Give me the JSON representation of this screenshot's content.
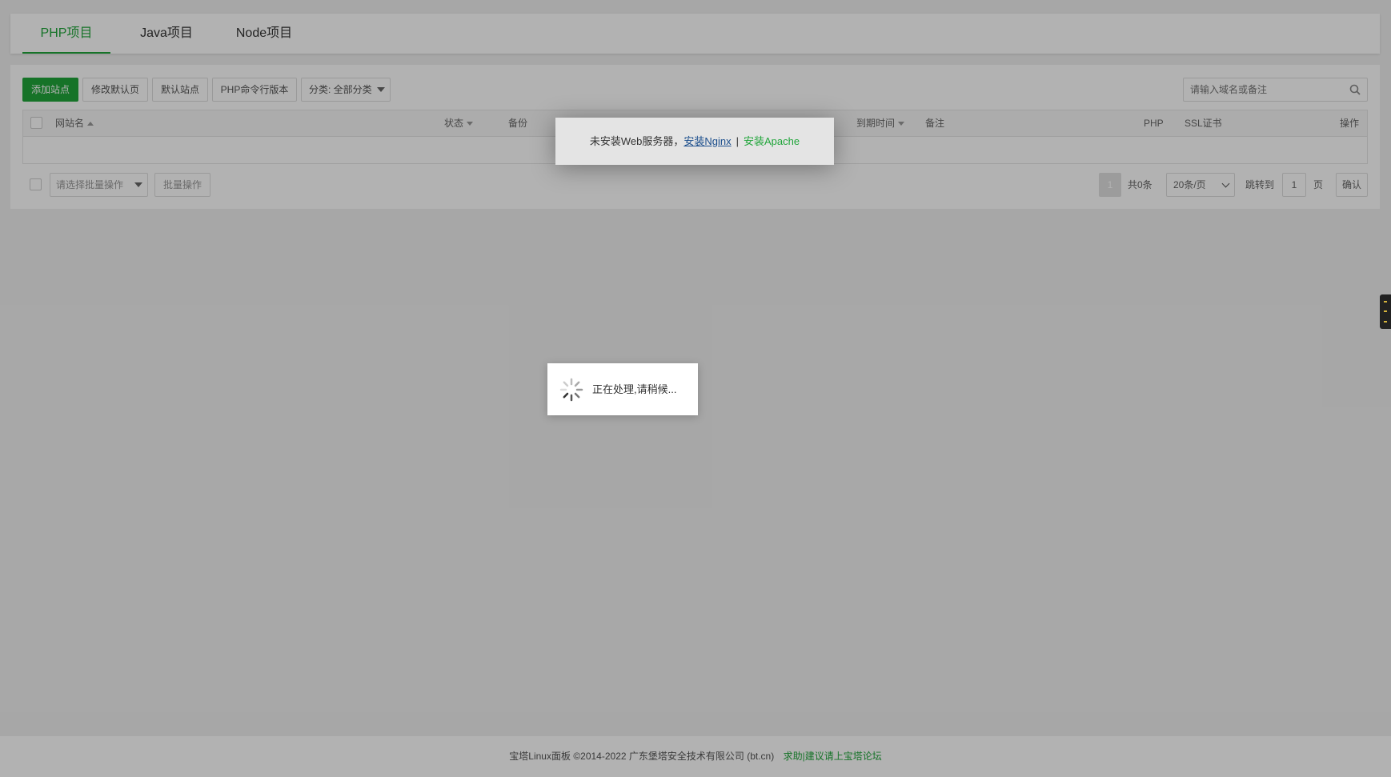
{
  "tabs": [
    {
      "label": "PHP项目"
    },
    {
      "label": "Java项目"
    },
    {
      "label": "Node项目"
    }
  ],
  "toolbar": {
    "add_site": "添加站点",
    "modify_default_page": "修改默认页",
    "default_site": "默认站点",
    "php_cli_version": "PHP命令行版本",
    "category": "分类: 全部分类"
  },
  "search": {
    "placeholder": "请输入域名或备注"
  },
  "table": {
    "headers": {
      "site_name": "网站名",
      "status": "状态",
      "backup": "备份",
      "expire": "到期时间",
      "remark": "备注",
      "php": "PHP",
      "ssl": "SSL证书",
      "actions": "操作"
    }
  },
  "batch": {
    "select_placeholder": "请选择批量操作",
    "button": "批量操作"
  },
  "pager": {
    "current": "1",
    "total": "共0条",
    "page_size": "20条/页",
    "jump_label": "跳转到",
    "jump_value": "1",
    "page_unit": "页",
    "confirm": "确认"
  },
  "warning": {
    "message": "未安装Web服务器，",
    "install_nginx": "安装Nginx",
    "separator": "|",
    "install_apache": "安装Apache"
  },
  "loading": {
    "text": "正在处理,请稍候..."
  },
  "footer": {
    "copyright": "宝塔Linux面板 ©2014-2022 广东堡塔安全技术有限公司 (bt.cn)",
    "forum_link": "求助|建议请上宝塔论坛"
  },
  "colors": {
    "accent": "#20a53a"
  }
}
